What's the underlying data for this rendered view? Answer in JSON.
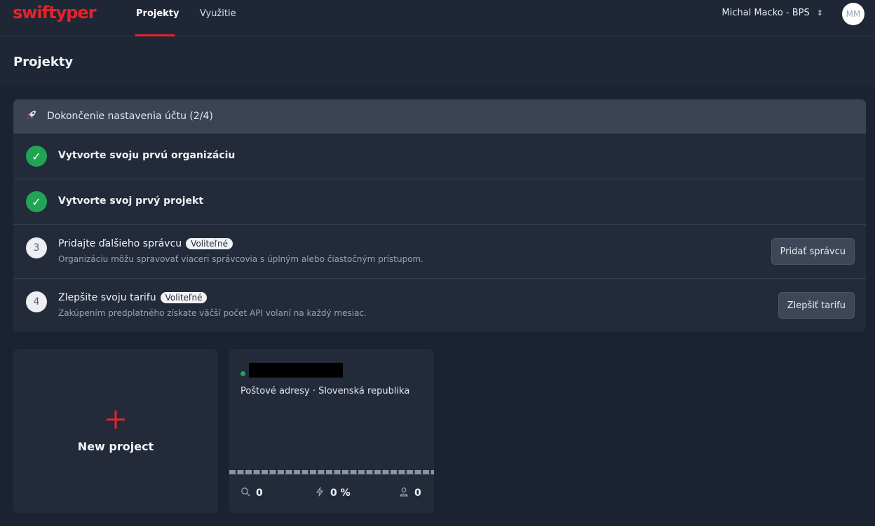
{
  "nav": {
    "logo": "swiftyper",
    "tabs": [
      {
        "label": "Projekty",
        "active": true
      },
      {
        "label": "Využitie",
        "active": false
      }
    ],
    "user": "Michal Macko - BPS",
    "avatar_initials": "MM"
  },
  "page": {
    "title": "Projekty"
  },
  "setup": {
    "title": "Dokončenie nastavenia účtu (2/4)",
    "steps": [
      {
        "status": "done",
        "title": "Vytvorte svoju prvú organizáciu"
      },
      {
        "status": "done",
        "title": "Vytvorte svoj prvý projekt"
      },
      {
        "status": "todo",
        "number": "3",
        "title": "Pridajte ďalšieho správcu",
        "badge": "Voliteľné",
        "description": "Organizáciu môžu spravovať viaceri správcovia s úplným alebo čiastočným prístupom.",
        "button": "Pridať správcu"
      },
      {
        "status": "todo",
        "number": "4",
        "title": "Zlepšite svoju tarifu",
        "badge": "Voliteľné",
        "description": "Zakúpením predplatného získate väčší počet API volaní na každý mesiac.",
        "button": "Zlepšiť tarifu"
      }
    ]
  },
  "new_project": {
    "label": "New project"
  },
  "project": {
    "subtitle": "Poštové adresy · Slovenská republika",
    "stats": {
      "searches": "0",
      "rate": "0 %",
      "users": "0"
    }
  },
  "icons": {
    "rocket": "rocket-icon",
    "check": "check-icon",
    "plus": "plus-icon",
    "search": "search-icon",
    "bolt": "bolt-icon",
    "user": "user-icon",
    "chevron": "chevron-updown-icon"
  },
  "colors": {
    "brand": "#e8222a",
    "success": "#22a455",
    "background": "#1b2231"
  }
}
